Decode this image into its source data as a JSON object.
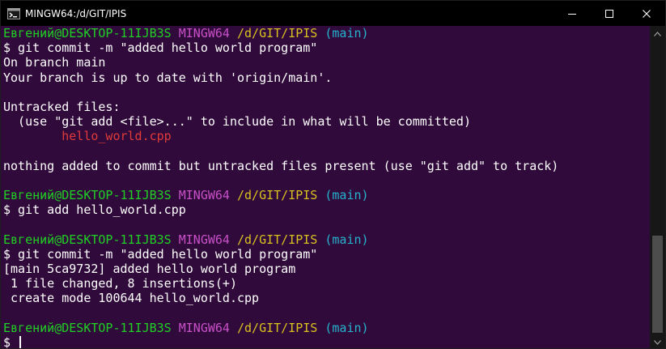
{
  "window": {
    "title": "MINGW64:/d/GIT/IPIS",
    "buttons": {
      "minimize_icon": "minimize-icon",
      "maximize_icon": "maximize-icon",
      "close_icon": "close-icon"
    }
  },
  "colors": {
    "background": "#300a3a",
    "user_host": "#20d024",
    "mingw": "#c850c8",
    "path": "#d8c020",
    "branch": "#27b2ce",
    "untracked_file": "#e03a3a",
    "text": "#ffffff"
  },
  "prompt": {
    "user_host": "Евгений@DESKTOP-11IJB3S",
    "mingw": "MINGW64",
    "path": "/d/GIT/IPIS",
    "branch": "(main)",
    "symbol": "$"
  },
  "lines": [
    {
      "type": "prompt"
    },
    {
      "type": "text",
      "text": "$ git commit -m \"added hello world program\""
    },
    {
      "type": "text",
      "text": "On branch main"
    },
    {
      "type": "text",
      "text": "Your branch is up to date with 'origin/main'."
    },
    {
      "type": "blank",
      "text": ""
    },
    {
      "type": "text",
      "text": "Untracked files:"
    },
    {
      "type": "text",
      "text": "  (use \"git add <file>...\" to include in what will be committed)"
    },
    {
      "type": "red",
      "text": "        hello_world.cpp"
    },
    {
      "type": "blank",
      "text": ""
    },
    {
      "type": "text",
      "text": "nothing added to commit but untracked files present (use \"git add\" to track)"
    },
    {
      "type": "blank",
      "text": ""
    },
    {
      "type": "prompt"
    },
    {
      "type": "text",
      "text": "$ git add hello_world.cpp"
    },
    {
      "type": "blank",
      "text": ""
    },
    {
      "type": "prompt"
    },
    {
      "type": "text",
      "text": "$ git commit -m \"added hello world program\""
    },
    {
      "type": "text",
      "text": "[main 5ca9732] added hello world program"
    },
    {
      "type": "text",
      "text": " 1 file changed, 8 insertions(+)"
    },
    {
      "type": "text",
      "text": " create mode 100644 hello_world.cpp"
    },
    {
      "type": "blank",
      "text": ""
    },
    {
      "type": "prompt"
    },
    {
      "type": "input",
      "text": "$ "
    }
  ]
}
